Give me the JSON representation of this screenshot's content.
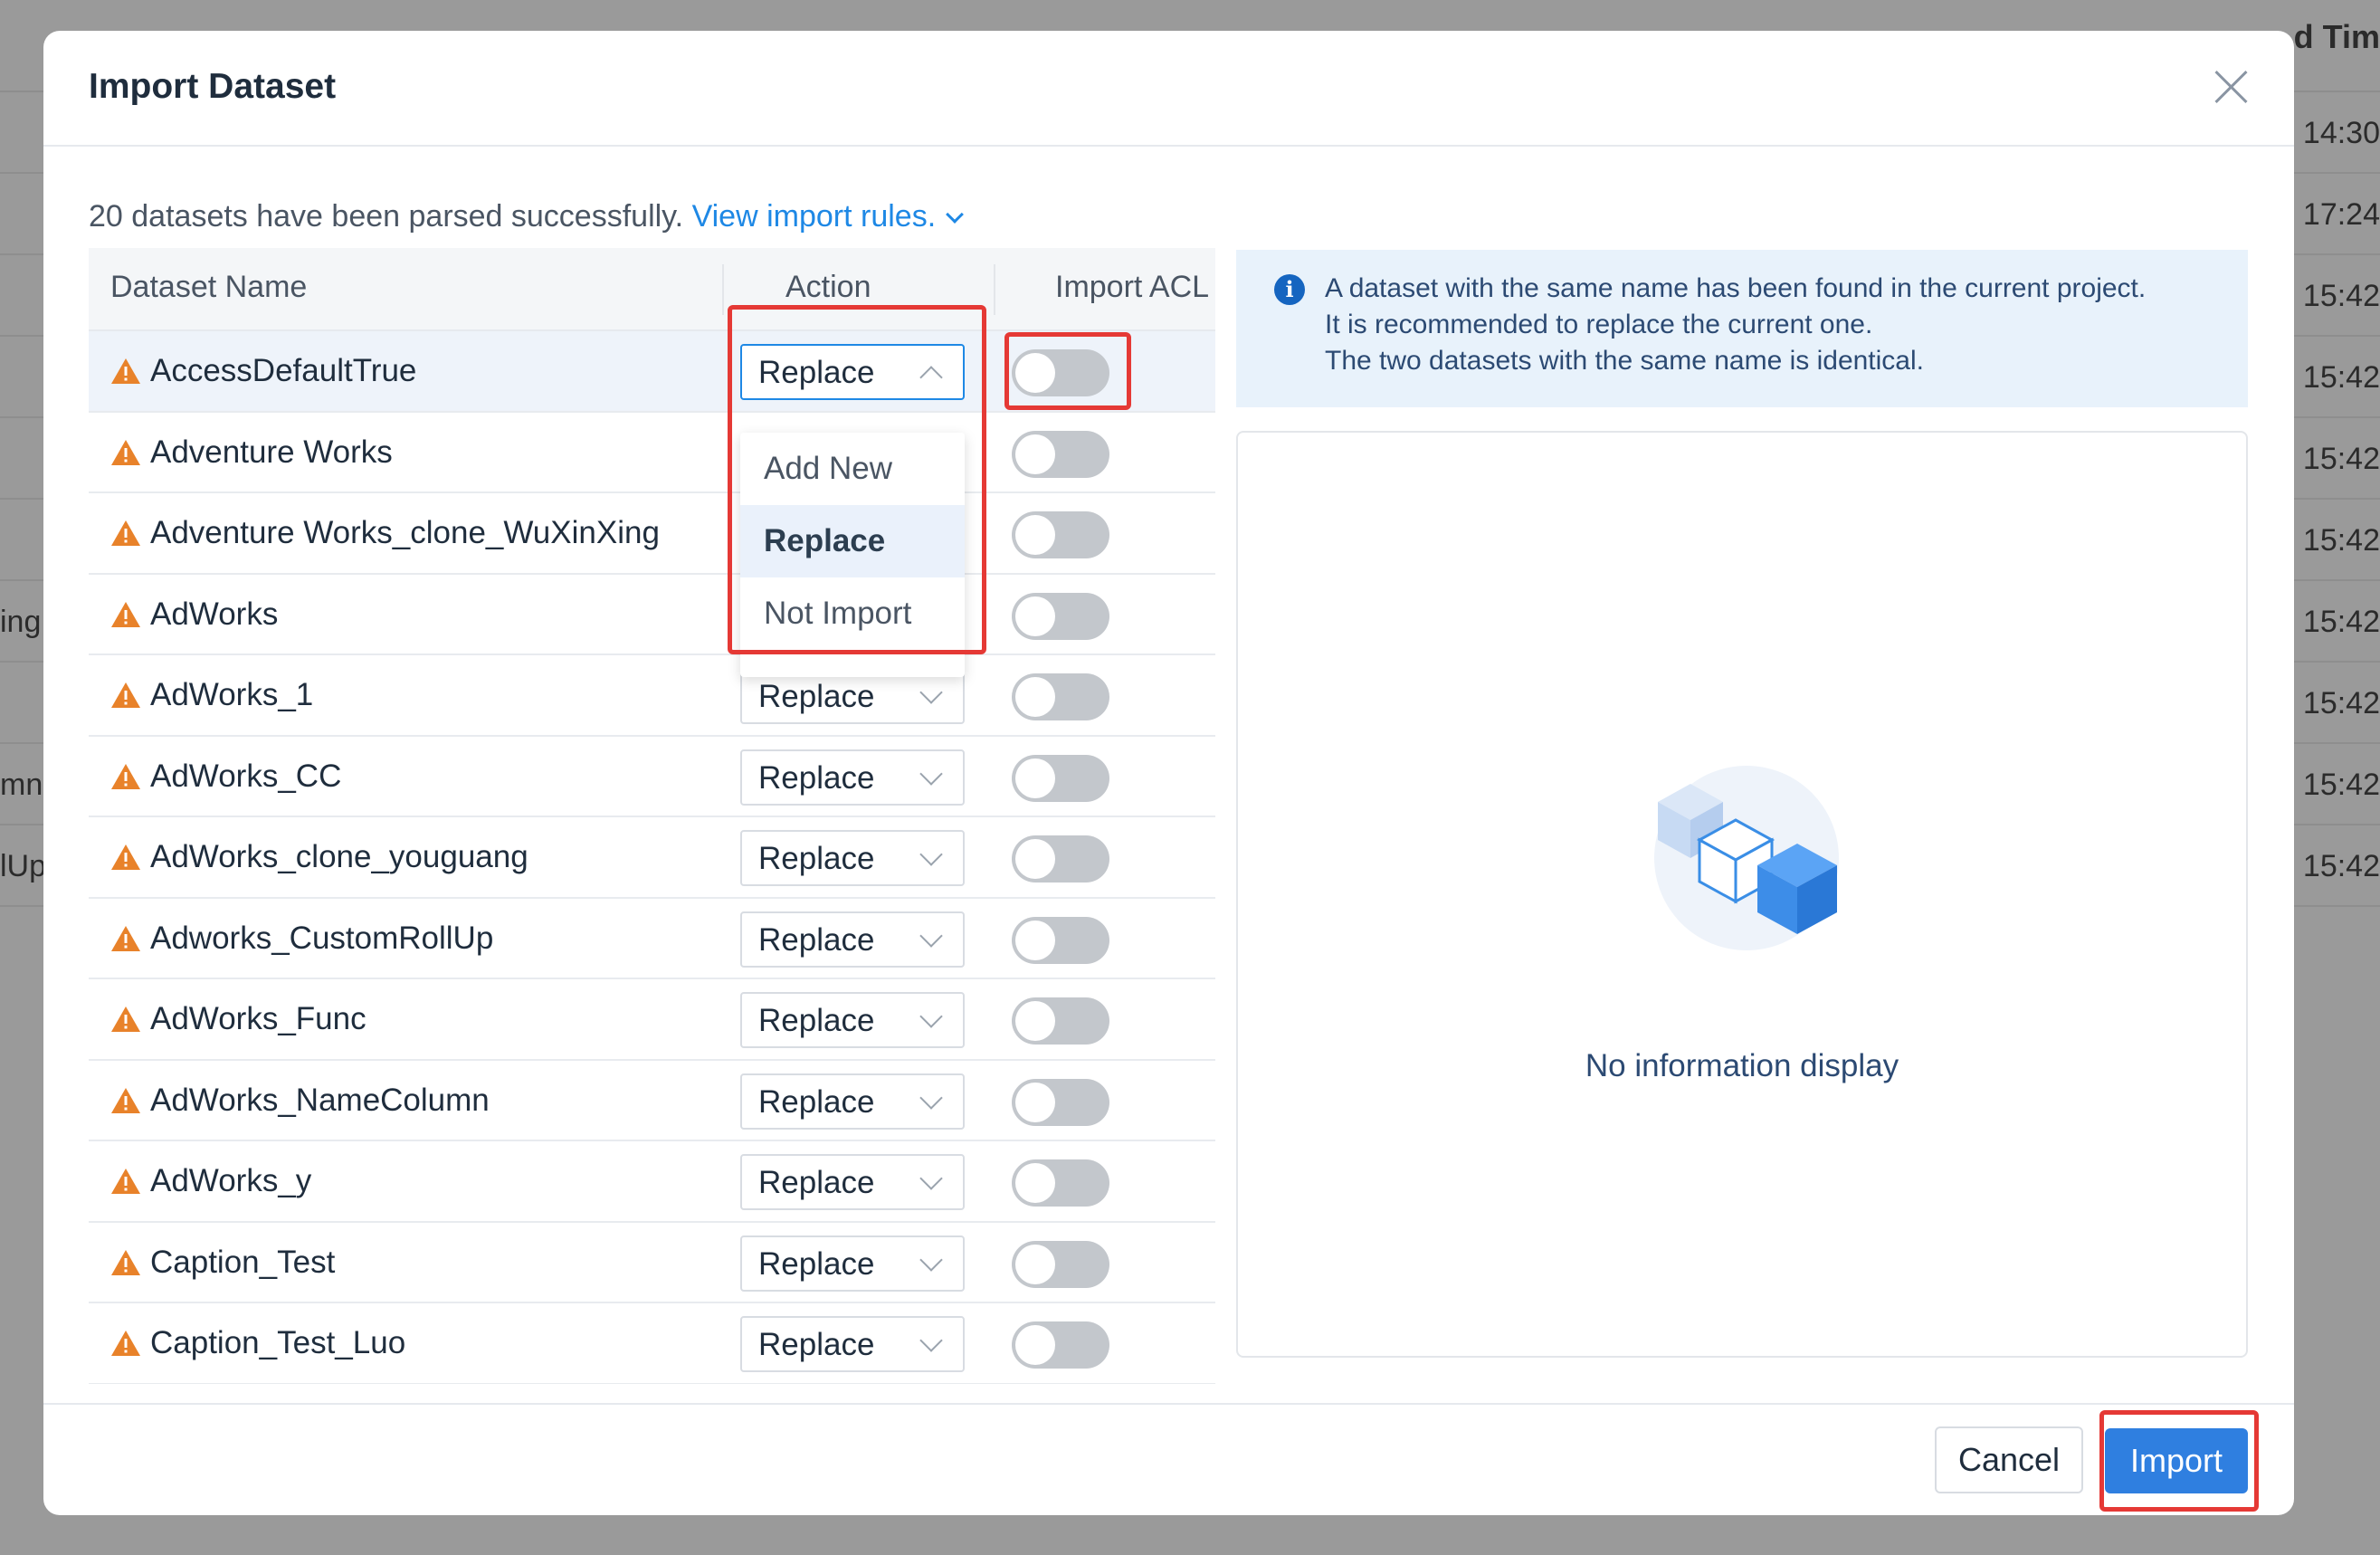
{
  "background": {
    "header": "d Tim",
    "times": [
      "14:30",
      "17:24",
      "15:42",
      "15:42",
      "15:42",
      "15:42",
      "15:42",
      "15:42",
      "15:42",
      "15:42"
    ],
    "left_fragments": [
      "ing",
      "mn",
      "lUp"
    ]
  },
  "modal": {
    "title": "Import Dataset",
    "summary_text": "20 datasets have been parsed successfully.",
    "rules_link": "View import rules.",
    "columns": {
      "name": "Dataset Name",
      "action": "Action",
      "acl": "Import ACL"
    },
    "rows": [
      {
        "name": "AccessDefaultTrue",
        "action": "Replace",
        "acl": false
      },
      {
        "name": "Adventure Works",
        "action": "",
        "acl": false
      },
      {
        "name": "Adventure Works_clone_WuXinXing",
        "action": "",
        "acl": false
      },
      {
        "name": "AdWorks",
        "action": "",
        "acl": false
      },
      {
        "name": "AdWorks_1",
        "action": "Replace",
        "acl": false
      },
      {
        "name": "AdWorks_CC",
        "action": "Replace",
        "acl": false
      },
      {
        "name": "AdWorks_clone_youguang",
        "action": "Replace",
        "acl": false
      },
      {
        "name": "Adworks_CustomRollUp",
        "action": "Replace",
        "acl": false
      },
      {
        "name": "AdWorks_Func",
        "action": "Replace",
        "acl": false
      },
      {
        "name": "AdWorks_NameColumn",
        "action": "Replace",
        "acl": false
      },
      {
        "name": "AdWorks_y",
        "action": "Replace",
        "acl": false
      },
      {
        "name": "Caption_Test",
        "action": "Replace",
        "acl": false
      },
      {
        "name": "Caption_Test_Luo",
        "action": "Replace",
        "acl": false
      }
    ],
    "dropdown_options": [
      "Add New",
      "Replace",
      "Not Import"
    ],
    "dropdown_selected": "Replace",
    "info_lines": [
      "A dataset with the same name has been found in the current project.",
      "It is recommended to replace the current one.",
      "The two datasets with the same name is identical."
    ],
    "empty_text": "No information display",
    "cancel_label": "Cancel",
    "import_label": "Import"
  },
  "colors": {
    "accent": "#2f7fe0",
    "warning": "#e8822a",
    "highlight": "#e53935",
    "info_bg": "#e8f2fb"
  }
}
